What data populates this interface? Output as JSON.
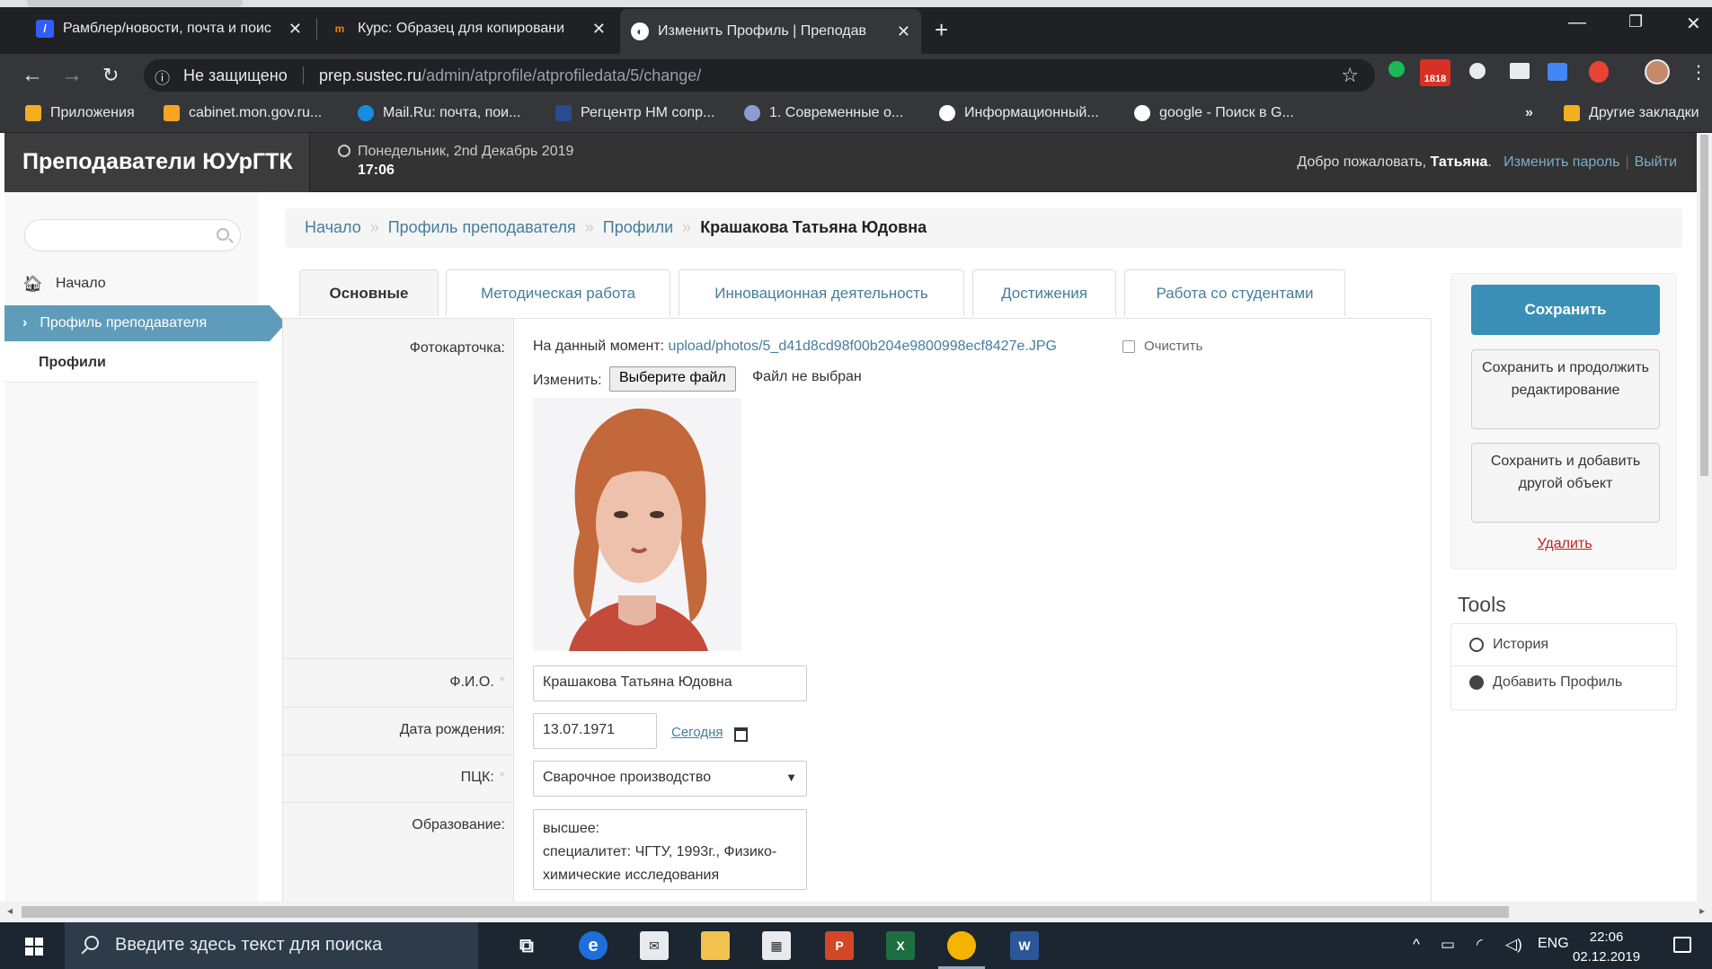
{
  "browser": {
    "tabs": [
      {
        "title": "Рамблер/новости, почта и поис",
        "favicon_color": "#315efb"
      },
      {
        "title": "Курс: Образец для копировани",
        "favicon_color": "#f57c00"
      },
      {
        "title": "Изменить Профиль | Преподав",
        "favicon_color": "#ffffff"
      }
    ],
    "address": {
      "security": "Не защищено",
      "host": "prep.sustec.ru",
      "path": "/admin/atprofile/atprofiledata/5/change/"
    },
    "bookmarks": [
      {
        "label": "Приложения",
        "color": "#f2b01e"
      },
      {
        "label": "cabinet.mon.gov.ru...",
        "color": "#f5a623"
      },
      {
        "label": "Mail.Ru: почта, пои...",
        "color": "#168de2"
      },
      {
        "label": "Регцентр НМ сопр...",
        "color": "#2a4b8d"
      },
      {
        "label": "1. Современные о...",
        "color": "#8e9bd1"
      },
      {
        "label": "Информационный...",
        "color": "#ffffff"
      },
      {
        "label": "google - Поиск в G...",
        "color": "#ffffff"
      }
    ],
    "bookmarks_more": "»",
    "other_bookmarks": "Другие закладки",
    "badge_count": "1818"
  },
  "header": {
    "brand": "Преподаватели ЮУрГТК",
    "date": "Понедельник, 2nd Декабрь 2019",
    "time": "17:06",
    "welcome": "Добро пожаловать,",
    "user": "Татьяна",
    "change_password": "Изменить пароль",
    "sep": "|",
    "logout": "Выйти"
  },
  "sidebar": {
    "search_placeholder": "",
    "home": "Начало",
    "active": "Профиль преподавателя",
    "sub": "Профили"
  },
  "breadcrumbs": {
    "home": "Начало",
    "app": "Профиль преподавателя",
    "model": "Профили",
    "current": "Крашакова Татьяна Юдовна",
    "sep": "»"
  },
  "tabs": [
    "Основные",
    "Методическая работа",
    "Инновационная деятельность",
    "Достижения",
    "Работа со студентами"
  ],
  "form": {
    "photo_label": "Фотокарточка:",
    "current_label": "На данный момент:",
    "current_file": "upload/photos/5_d41d8cd98f00b204e9800998ecf8427e.JPG",
    "clear_label": "Очистить",
    "change_label": "Изменить:",
    "choose_file": "Выберите файл",
    "no_file": "Файл не выбран",
    "fio_label": "Ф.И.О.",
    "fio_value": "Крашакова Татьяна Юдовна",
    "birth_label": "Дата рождения:",
    "birth_value": "13.07.1971",
    "today": "Сегодня",
    "pck_label": "ПЦК:",
    "pck_value": "Сварочное производство",
    "edu_label": "Образование:",
    "edu_value": "высшее:\nспециалитет: ЧГТУ, 1993г., Физико-химические исследования",
    "required": "*"
  },
  "actions": {
    "save": "Сохранить",
    "save_continue": "Сохранить и продолжить редактирование",
    "save_add": "Сохранить и добавить другой объект",
    "delete": "Удалить"
  },
  "tools": {
    "title": "Tools",
    "history": "История",
    "add": "Добавить Профиль"
  },
  "taskbar": {
    "search": "Введите здесь текст для поиска",
    "lang": "ENG",
    "time": "22:06",
    "date": "02.12.2019"
  }
}
